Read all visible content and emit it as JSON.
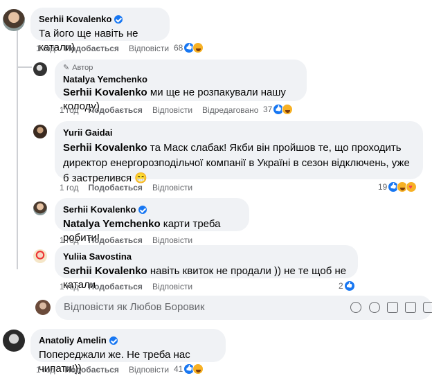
{
  "c1": {
    "name": "Serhii Kovalenko",
    "text": "Та його ще навіть не катали)",
    "time": "1 год",
    "like": "Подобається",
    "reply": "Відповісти",
    "count": "68"
  },
  "c2": {
    "author_tag": "Автор",
    "name": "Natalya Yemchenko",
    "mention": "Serhii Kovalenko",
    "text": " ми ще не розпакували нашу колоду)",
    "time": "1 год",
    "like": "Подобається",
    "reply": "Відповісти",
    "edited": "Відредаговано",
    "count": "37"
  },
  "c3": {
    "name": "Yurii Gaidai",
    "mention": "Serhii Kovalenko",
    "text": " та Маск слабак! Якби він пройшов те, що проходить директор енергорозподільчої компанії в Україні в сезон відключень, уже б застрелився 😁",
    "time": "1 год",
    "like": "Подобається",
    "reply": "Відповісти",
    "count": "19"
  },
  "c4": {
    "name": "Serhii Kovalenko",
    "mention": "Natalya Yemchenko",
    "text": " карти треба робити!",
    "time": "1 год",
    "like": "Подобається",
    "reply": "Відповісти"
  },
  "c5": {
    "name": "Yuliia Savostina",
    "mention": "Serhii Kovalenko",
    "text": " навіть квиток не продали )) не те щоб не катали",
    "time": "1 год",
    "like": "Подобається",
    "reply": "Відповісти",
    "count": "2"
  },
  "reply_box": {
    "placeholder": "Відповісти як Любов Боровик"
  },
  "c6": {
    "name": "Anatoliy Amelin",
    "text": "Попереджали же. Не треба нас чипати!))",
    "time": "1 год",
    "like": "Подобається",
    "reply": "Відповісти",
    "count": "41"
  },
  "colors": {
    "link": "#1877f2",
    "meta": "#65676b",
    "bubble": "#f0f2f5"
  },
  "icons": [
    "verified-badge-icon",
    "like-reaction-icon",
    "haha-reaction-icon",
    "care-reaction-icon",
    "pencil-icon",
    "emoji-icon",
    "sticker-icon",
    "camera-icon",
    "gif-icon",
    "avatar-sticker-icon"
  ]
}
